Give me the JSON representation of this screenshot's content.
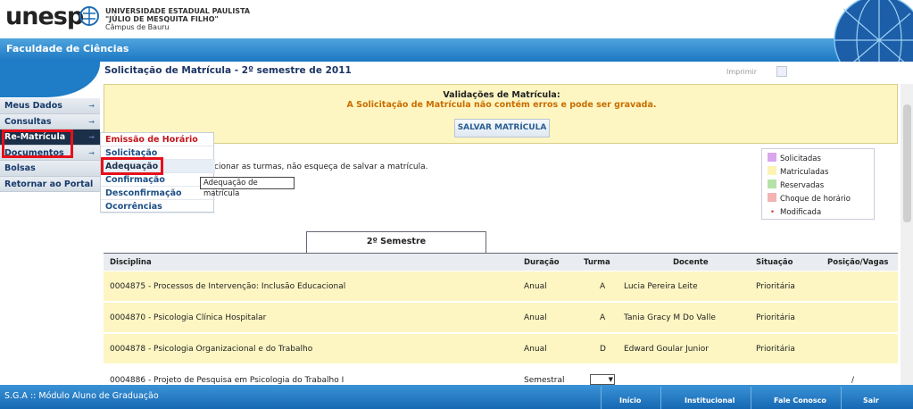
{
  "header": {
    "logo": "unesp",
    "university_line1": "UNIVERSIDADE ESTADUAL PAULISTA",
    "university_line2": "\"JÚLIO DE MESQUITA FILHO\"",
    "campus": "Câmpus de Bauru"
  },
  "faculty": "Faculdade de Ciências",
  "sidebar": {
    "items": [
      {
        "label": "Meus Dados"
      },
      {
        "label": "Consultas"
      },
      {
        "label": "Re-Matrícula"
      },
      {
        "label": "Documentos"
      },
      {
        "label": "Bolsas"
      },
      {
        "label": "Retornar ao Portal"
      }
    ]
  },
  "submenu": {
    "items": [
      {
        "label": "Emissão de Horário"
      },
      {
        "label": "Solicitação"
      },
      {
        "label": "Adequação"
      },
      {
        "label": "Confirmação"
      },
      {
        "label": "Desconfirmação"
      },
      {
        "label": "Ocorrências"
      }
    ],
    "tooltip": "Adequação de matrícula"
  },
  "page": {
    "title": "Solicitação de Matrícula - 2º semestre de 2011",
    "print_label": "Imprimir"
  },
  "validation": {
    "title": "Validações de Matrícula:",
    "message": "A Solicitação de Matrícula não contém erros e pode ser gravada.",
    "save_button": "SALVAR MATRÍCULA"
  },
  "hint": "cionar as turmas, não esqueça de salvar a matrícula.",
  "legend": {
    "items": [
      {
        "label": "Solicitadas",
        "color": "#d9a6ef"
      },
      {
        "label": "Matriculadas",
        "color": "#fdf3b5"
      },
      {
        "label": "Reservadas",
        "color": "#b5e2a8"
      },
      {
        "label": "Choque de horário",
        "color": "#f4b3b3"
      },
      {
        "label": "Modificada",
        "color": "#d23a3a"
      }
    ]
  },
  "tab": "2º Semestre",
  "table": {
    "headers": [
      "Disciplina",
      "Duração",
      "Turma",
      "Docente",
      "Situação",
      "Posição/Vagas"
    ],
    "rows": [
      {
        "disciplina": "0004875 - Processos de Intervenção: Inclusão Educacional",
        "duracao": "Anual",
        "turma": "A",
        "docente": "Lucia Pereira Leite",
        "situacao": "Prioritária",
        "posicao": ""
      },
      {
        "disciplina": "0004870 - Psicologia Clínica Hospitalar",
        "duracao": "Anual",
        "turma": "A",
        "docente": "Tania Gracy M Do Valle",
        "situacao": "Prioritária",
        "posicao": ""
      },
      {
        "disciplina": "0004878 - Psicologia Organizacional e do Trabalho",
        "duracao": "Anual",
        "turma": "D",
        "docente": "Edward Goular Junior",
        "situacao": "Prioritária",
        "posicao": ""
      },
      {
        "disciplina": "0004886 - Projeto de Pesquisa em Psicologia do Trabalho I",
        "duracao": "Semestral",
        "turma": "",
        "docente": "",
        "situacao": "",
        "posicao": "/"
      }
    ]
  },
  "footer": {
    "title": "S.G.A :: Módulo Aluno de Graduação",
    "links": [
      "Início",
      "Institucional",
      "Fale Conosco",
      "Sair"
    ]
  }
}
